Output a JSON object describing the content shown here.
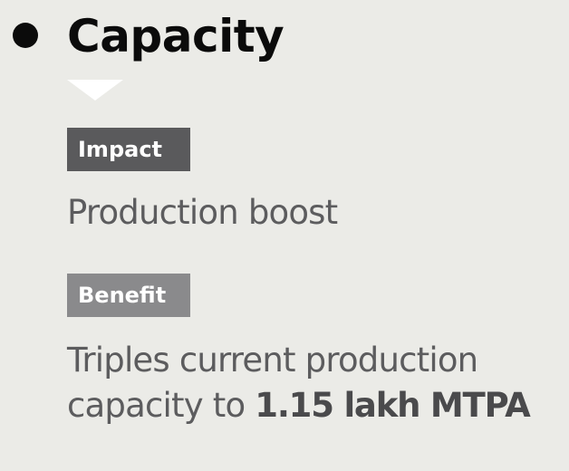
{
  "heading": {
    "title": "Capacity"
  },
  "impact": {
    "label": "Impact",
    "text": "Production boost"
  },
  "benefit": {
    "label": "Benefit",
    "line1": "Triples current production",
    "line2_prefix": "capacity to ",
    "line2_emphasis": "1.15 lakh MTPA"
  },
  "colors": {
    "background": "#ebebe7",
    "title_text": "#0b0b0b",
    "impact_tag": "#5a5a5c",
    "benefit_tag": "#8a8a8c",
    "body_text": "#5c5c5e",
    "pointer": "#ffffff"
  }
}
